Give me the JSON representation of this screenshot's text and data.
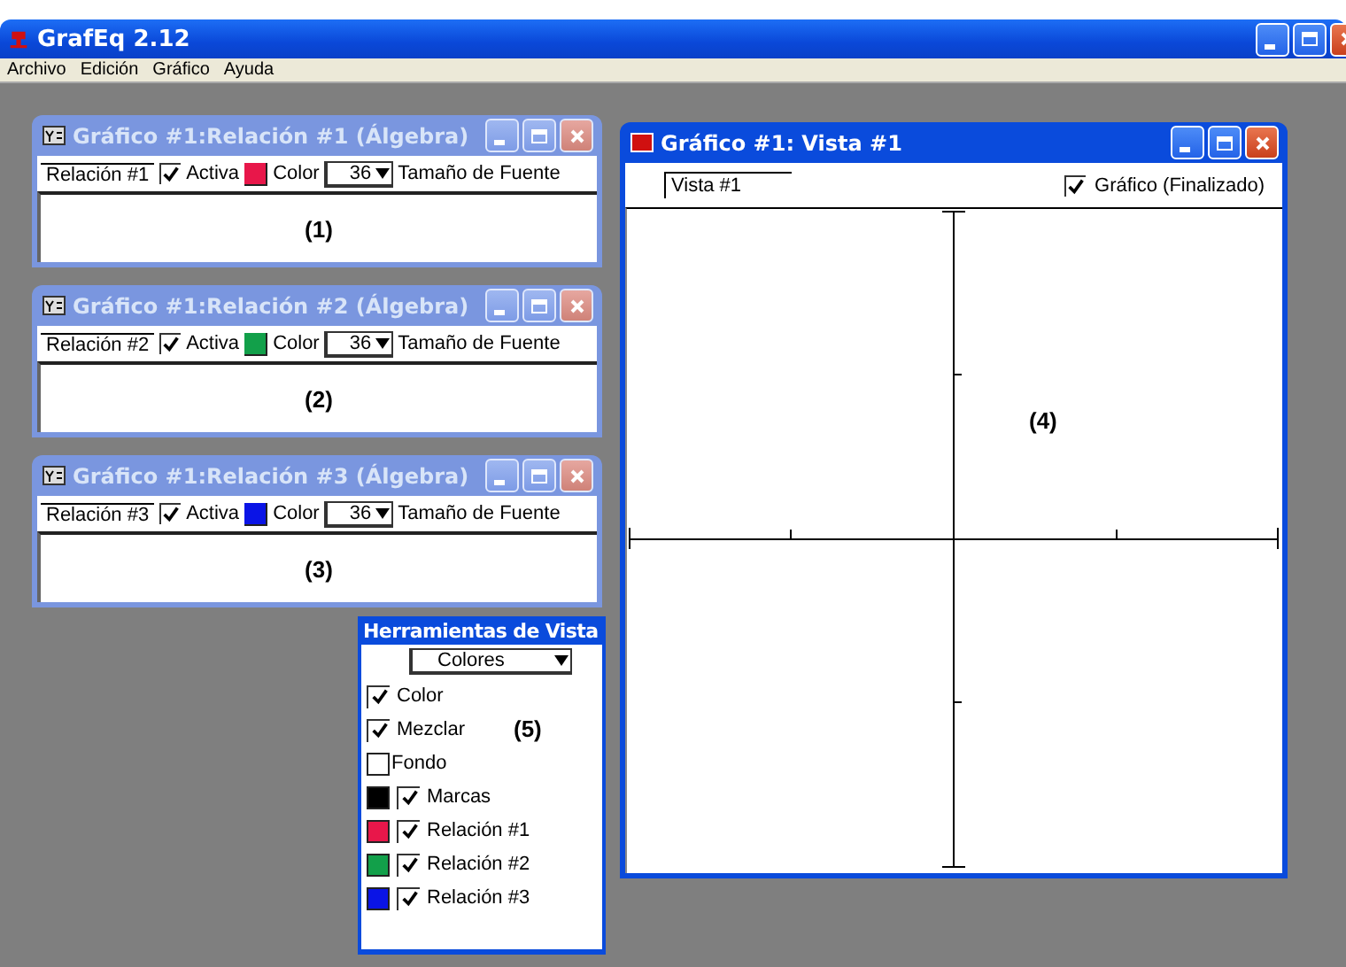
{
  "app": {
    "title": "GrafEq 2.12"
  },
  "menu": [
    "Archivo",
    "Edición",
    "Gráfico",
    "Ayuda"
  ],
  "relations": [
    {
      "title": "Gráfico #1:Relación #1 (Álgebra)",
      "name": "Relación #1",
      "active_label": "Activa",
      "active": true,
      "color": "#e8174a",
      "color_label": "Color",
      "font_size": "36",
      "font_size_label": "Tamaño de Fuente",
      "content": "(1)"
    },
    {
      "title": "Gráfico #1:Relación #2 (Álgebra)",
      "name": "Relación #2",
      "active_label": "Activa",
      "active": true,
      "color": "#12a04a",
      "color_label": "Color",
      "font_size": "36",
      "font_size_label": "Tamaño de Fuente",
      "content": "(2)"
    },
    {
      "title": "Gráfico #1:Relación #3 (Álgebra)",
      "name": "Relación #3",
      "active_label": "Activa",
      "active": true,
      "color": "#0a14e6",
      "color_label": "Color",
      "font_size": "36",
      "font_size_label": "Tamaño de Fuente",
      "content": "(3)"
    }
  ],
  "view": {
    "title": "Gráfico #1: Vista #1",
    "name": "Vista #1",
    "graph_label": "Gráfico (Finalizado)",
    "graph_checked": true,
    "annotation": "(4)"
  },
  "tools": {
    "title": "Herramientas de Vista",
    "dropdown": "Colores",
    "annotation": "(5)",
    "items": [
      {
        "kind": "check",
        "label": "Color",
        "checked": true
      },
      {
        "kind": "check",
        "label": "Mezclar",
        "checked": true
      },
      {
        "kind": "swatch",
        "label": "Fondo",
        "color": "#ffffff"
      },
      {
        "kind": "swatch-check",
        "label": "Marcas",
        "color": "#000000",
        "checked": true
      },
      {
        "kind": "swatch-check",
        "label": "Relación #1",
        "color": "#e8174a",
        "checked": true
      },
      {
        "kind": "swatch-check",
        "label": "Relación #2",
        "color": "#12a04a",
        "checked": true
      },
      {
        "kind": "swatch-check",
        "label": "Relación #3",
        "color": "#0a14e6",
        "checked": true
      }
    ]
  }
}
